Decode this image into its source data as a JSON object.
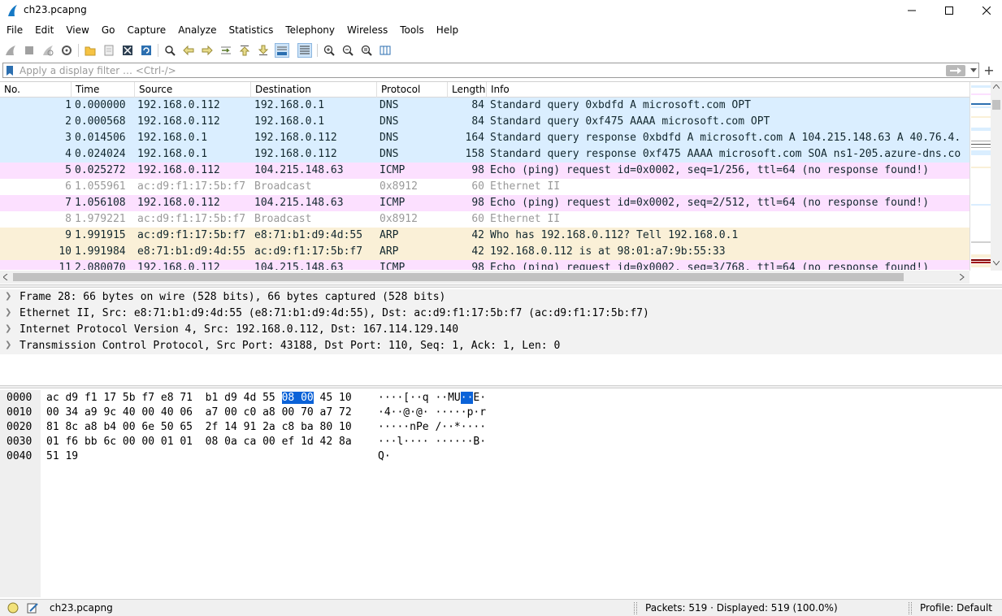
{
  "window": {
    "title": "ch23.pcapng"
  },
  "menu": [
    "File",
    "Edit",
    "View",
    "Go",
    "Capture",
    "Analyze",
    "Statistics",
    "Telephony",
    "Wireless",
    "Tools",
    "Help"
  ],
  "filter": {
    "placeholder": "Apply a display filter … <Ctrl-/>",
    "value": ""
  },
  "columns": {
    "no": "No.",
    "time": "Time",
    "source": "Source",
    "destination": "Destination",
    "protocol": "Protocol",
    "length": "Length",
    "info": "Info"
  },
  "packets": [
    {
      "no": "1",
      "time": "0.000000",
      "source": "192.168.0.112",
      "destination": "192.168.0.1",
      "protocol": "DNS",
      "length": "84",
      "info": "Standard query 0xbdfd A microsoft.com OPT",
      "bg": "#daeeff",
      "fg": "#12272e"
    },
    {
      "no": "2",
      "time": "0.000568",
      "source": "192.168.0.112",
      "destination": "192.168.0.1",
      "protocol": "DNS",
      "length": "84",
      "info": "Standard query 0xf475 AAAA microsoft.com OPT",
      "bg": "#daeeff",
      "fg": "#12272e"
    },
    {
      "no": "3",
      "time": "0.014506",
      "source": "192.168.0.1",
      "destination": "192.168.0.112",
      "protocol": "DNS",
      "length": "164",
      "info": "Standard query response 0xbdfd A microsoft.com A 104.215.148.63 A 40.76.4.",
      "bg": "#daeeff",
      "fg": "#12272e"
    },
    {
      "no": "4",
      "time": "0.024024",
      "source": "192.168.0.1",
      "destination": "192.168.0.112",
      "protocol": "DNS",
      "length": "158",
      "info": "Standard query response 0xf475 AAAA microsoft.com SOA ns1-205.azure-dns.co",
      "bg": "#daeeff",
      "fg": "#12272e"
    },
    {
      "no": "5",
      "time": "0.025272",
      "source": "192.168.0.112",
      "destination": "104.215.148.63",
      "protocol": "ICMP",
      "length": "98",
      "info": "Echo (ping) request  id=0x0002, seq=1/256, ttl=64 (no response found!)",
      "bg": "#fce0ff",
      "fg": "#12272e"
    },
    {
      "no": "6",
      "time": "1.055961",
      "source": "ac:d9:f1:17:5b:f7",
      "destination": "Broadcast",
      "protocol": "0x8912",
      "length": "60",
      "info": "Ethernet II",
      "bg": "#ffffff",
      "fg": "#9a9a9a"
    },
    {
      "no": "7",
      "time": "1.056108",
      "source": "192.168.0.112",
      "destination": "104.215.148.63",
      "protocol": "ICMP",
      "length": "98",
      "info": "Echo (ping) request  id=0x0002, seq=2/512, ttl=64 (no response found!)",
      "bg": "#fce0ff",
      "fg": "#12272e"
    },
    {
      "no": "8",
      "time": "1.979221",
      "source": "ac:d9:f1:17:5b:f7",
      "destination": "Broadcast",
      "protocol": "0x8912",
      "length": "60",
      "info": "Ethernet II",
      "bg": "#ffffff",
      "fg": "#9a9a9a"
    },
    {
      "no": "9",
      "time": "1.991915",
      "source": "ac:d9:f1:17:5b:f7",
      "destination": "e8:71:b1:d9:4d:55",
      "protocol": "ARP",
      "length": "42",
      "info": "Who has 192.168.0.112? Tell 192.168.0.1",
      "bg": "#faf0d7",
      "fg": "#12272e"
    },
    {
      "no": "10",
      "time": "1.991984",
      "source": "e8:71:b1:d9:4d:55",
      "destination": "ac:d9:f1:17:5b:f7",
      "protocol": "ARP",
      "length": "42",
      "info": "192.168.0.112 is at 98:01:a7:9b:55:33",
      "bg": "#faf0d7",
      "fg": "#12272e"
    },
    {
      "no": "11",
      "time": "2.080070",
      "source": "192.168.0.112",
      "destination": "104.215.148.63",
      "protocol": "ICMP",
      "length": "98",
      "info": "Echo (ping) request  id=0x0002, seq=3/768, ttl=64 (no response found!)",
      "bg": "#fce0ff",
      "fg": "#12272e"
    }
  ],
  "details": [
    "Frame 28: 66 bytes on wire (528 bits), 66 bytes captured (528 bits)",
    "Ethernet II, Src: e8:71:b1:d9:4d:55 (e8:71:b1:d9:4d:55), Dst: ac:d9:f1:17:5b:f7 (ac:d9:f1:17:5b:f7)",
    "Internet Protocol Version 4, Src: 192.168.0.112, Dst: 167.114.129.140",
    "Transmission Control Protocol, Src Port: 43188, Dst Port: 110, Seq: 1, Ack: 1, Len: 0"
  ],
  "bytes": [
    {
      "offset": "0000",
      "hex_a": "ac d9 f1 17 5b f7 e8 71  b1 d9 4d 55 ",
      "hex_hl": "08 00",
      "hex_b": " 45 10",
      "ascii_a": "····[··q ··MU",
      "ascii_hl": "··",
      "ascii_b": "E·"
    },
    {
      "offset": "0010",
      "hex_a": "00 34 a9 9c 40 00 40 06  a7 00 c0 a8 00 70 a7 72",
      "hex_hl": "",
      "hex_b": "",
      "ascii_a": "·4··@·@· ·····p·r",
      "ascii_hl": "",
      "ascii_b": ""
    },
    {
      "offset": "0020",
      "hex_a": "81 8c a8 b4 00 6e 50 65  2f 14 91 2a c8 ba 80 10",
      "hex_hl": "",
      "hex_b": "",
      "ascii_a": "·····nPe /··*····",
      "ascii_hl": "",
      "ascii_b": ""
    },
    {
      "offset": "0030",
      "hex_a": "01 f6 bb 6c 00 00 01 01  08 0a ca 00 ef 1d 42 8a",
      "hex_hl": "",
      "hex_b": "",
      "ascii_a": "···l···· ······B·",
      "ascii_hl": "",
      "ascii_b": ""
    },
    {
      "offset": "0040",
      "hex_a": "51 19",
      "hex_hl": "",
      "hex_b": "",
      "ascii_a": "Q·",
      "ascii_hl": "",
      "ascii_b": ""
    }
  ],
  "status": {
    "file": "ch23.pcapng",
    "packets": "Packets: 519 · Displayed: 519 (100.0%)",
    "profile": "Profile: Default"
  },
  "colors": {
    "selection": "#0a62d8",
    "dns_bg": "#daeeff",
    "icmp_bg": "#fce0ff",
    "arp_bg": "#faf0d7"
  }
}
